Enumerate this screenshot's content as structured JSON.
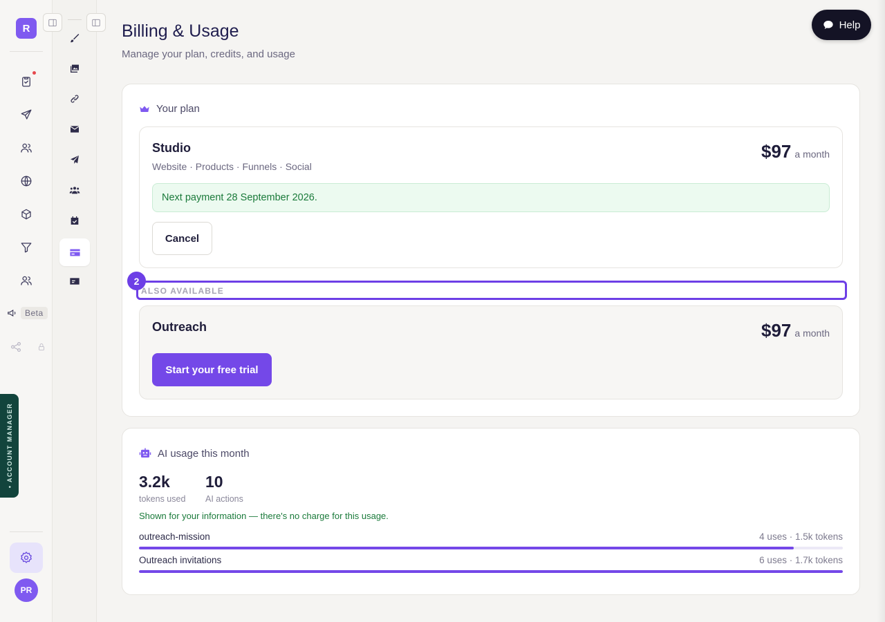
{
  "app": {
    "logo_letter": "R",
    "avatar_initials": "PR"
  },
  "rail": {
    "beta_label": "Beta",
    "account_manager_label": "• ACCOUNT MANAGER"
  },
  "header": {
    "title": "Billing & Usage",
    "subtitle": "Manage your plan, credits, and usage",
    "help_label": "Help"
  },
  "plan_section": {
    "heading": "Your plan",
    "current": {
      "name": "Studio",
      "features": "Website · Products · Funnels · Social",
      "price": "$97",
      "period": "a month",
      "next_payment": "Next payment 28 September 2026.",
      "cancel_label": "Cancel"
    },
    "also_available_label": "ALSO AVAILABLE",
    "step_badge": "2",
    "alternative": {
      "name": "Outreach",
      "price": "$97",
      "period": "a month",
      "trial_label": "Start your free trial"
    }
  },
  "usage_section": {
    "heading": "AI usage this month",
    "stats": [
      {
        "value": "3.2k",
        "label": "tokens used"
      },
      {
        "value": "10",
        "label": "AI actions"
      }
    ],
    "note": "Shown for your information — there's no charge for this usage.",
    "rows": [
      {
        "name": "outreach-mission",
        "meta": "4 uses · 1.5k tokens",
        "fill_fraction": 0.93
      },
      {
        "name": "Outreach invitations",
        "meta": "6 uses · 1.7k tokens",
        "fill_fraction": 1.0
      }
    ]
  },
  "colors": {
    "accent": "#7f5af0",
    "success": "#1a7a3a",
    "dark": "#141325"
  }
}
